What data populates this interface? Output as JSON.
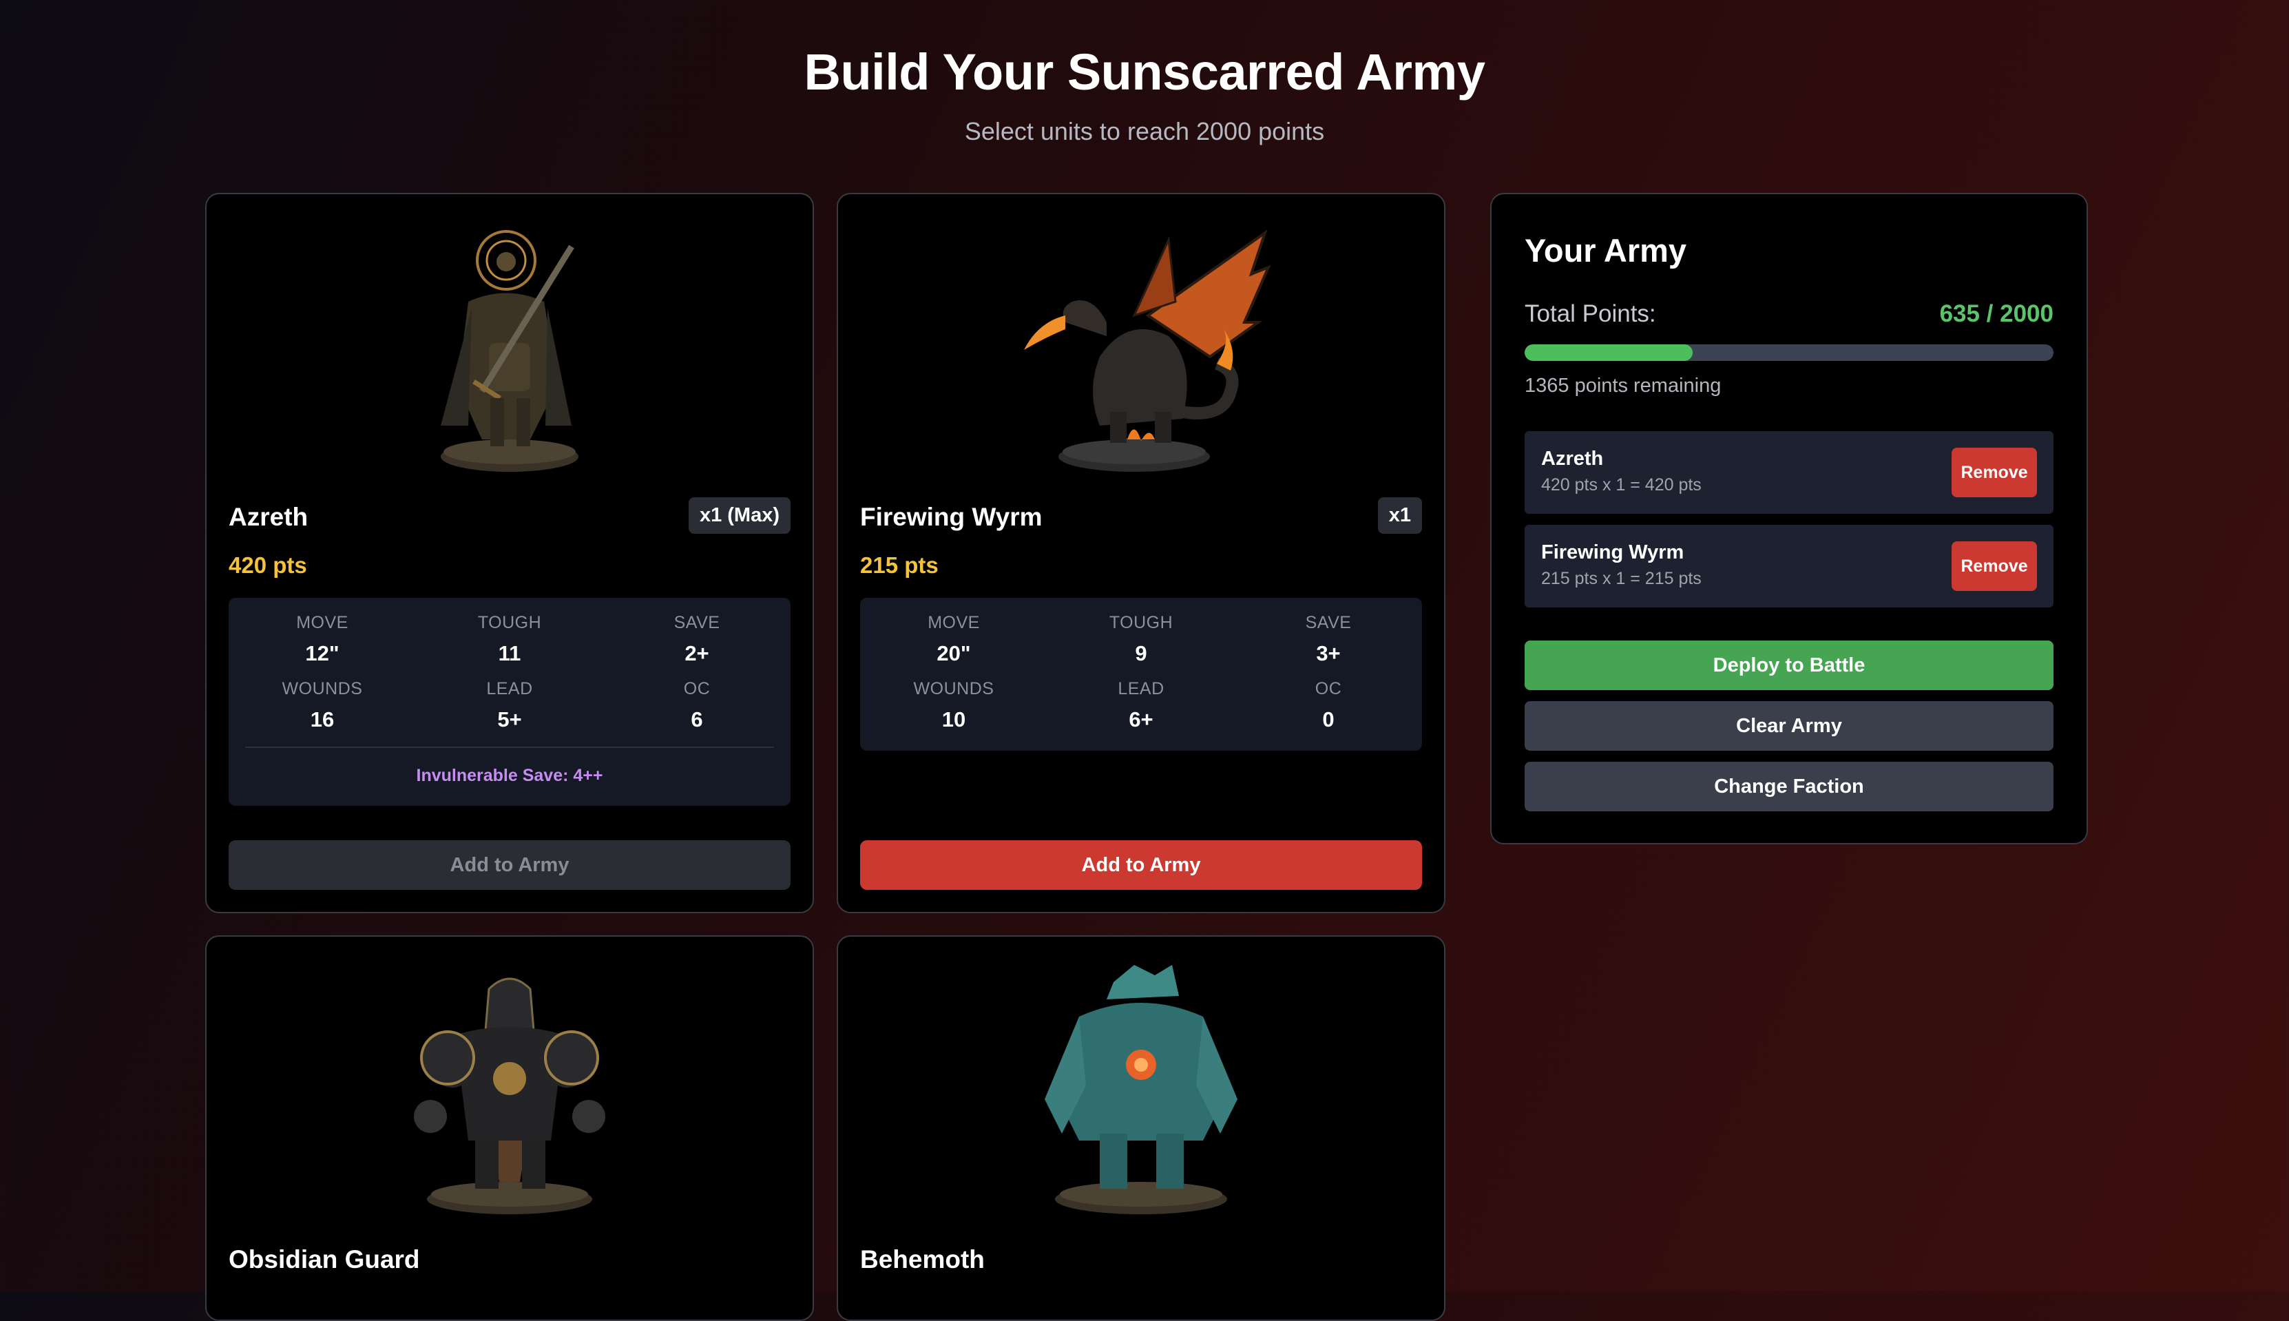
{
  "header": {
    "title": "Build Your Sunscarred Army",
    "subtitle": "Select units to reach 2000 points"
  },
  "stat_labels": [
    "MOVE",
    "TOUGH",
    "SAVE",
    "WOUNDS",
    "LEAD",
    "OC"
  ],
  "units": [
    {
      "name": "Azreth",
      "quantity": "x1 (Max)",
      "points": "420 pts",
      "stats": [
        "12\"",
        "11",
        "2+",
        "16",
        "5+",
        "6"
      ],
      "invulnerable": "Invulnerable Save: 4++",
      "add_label": "Add to Army",
      "add_enabled": false
    },
    {
      "name": "Firewing Wyrm",
      "quantity": "x1",
      "points": "215 pts",
      "stats": [
        "20\"",
        "9",
        "3+",
        "10",
        "6+",
        "0"
      ],
      "add_label": "Add to Army",
      "add_enabled": true
    },
    {
      "name": "Obsidian Guard"
    },
    {
      "name": "Behemoth"
    }
  ],
  "army": {
    "title": "Your Army",
    "total_label": "Total Points:",
    "total_value": "635 / 2000",
    "progress_fraction": 0.3175,
    "remaining": "1365 points remaining",
    "entries": [
      {
        "name": "Azreth",
        "detail": "420 pts x 1 = 420 pts",
        "remove_label": "Remove"
      },
      {
        "name": "Firewing Wyrm",
        "detail": "215 pts x 1 = 215 pts",
        "remove_label": "Remove"
      }
    ],
    "deploy_label": "Deploy to Battle",
    "clear_label": "Clear Army",
    "change_label": "Change Faction"
  },
  "colors": {
    "points": "#f5c33b",
    "accent_red": "#cb3931",
    "accent_green": "#45a552",
    "invulnerable": "#c68cf2"
  }
}
